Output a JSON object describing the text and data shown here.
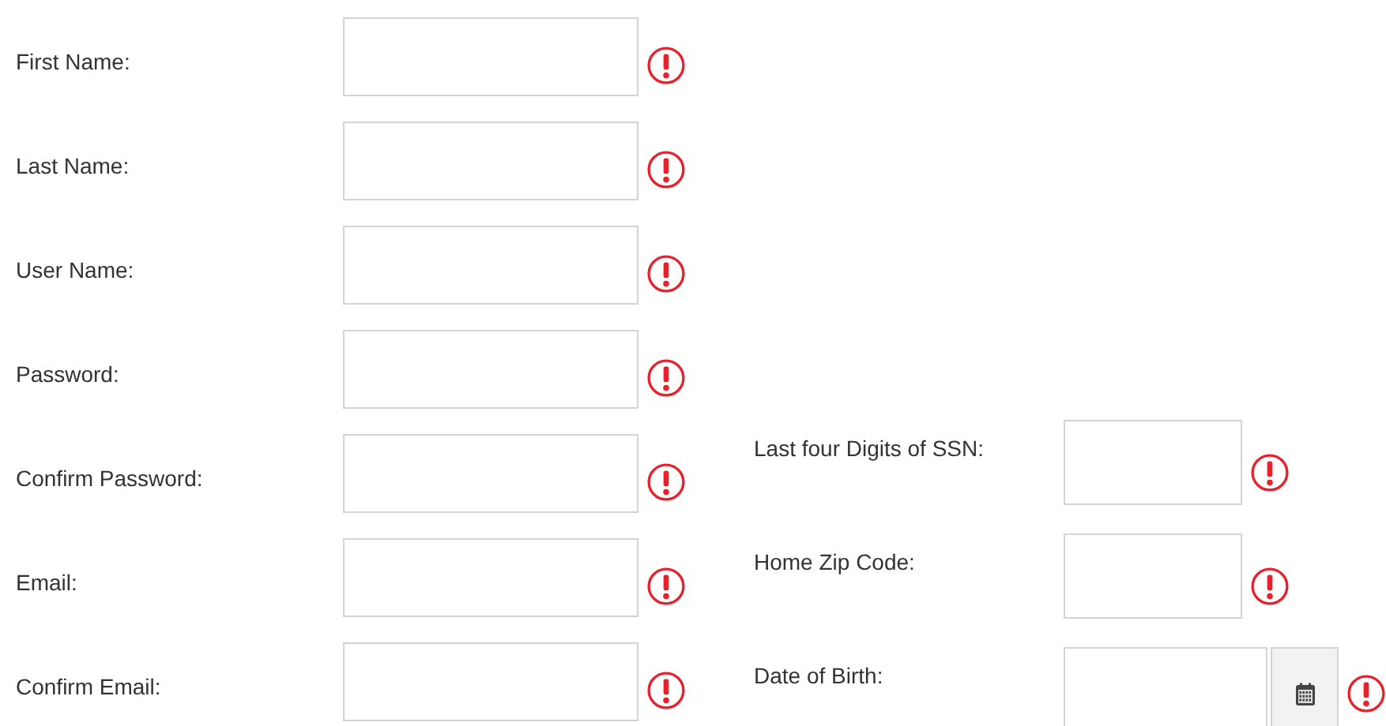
{
  "left_fields": [
    {
      "label": "First Name:",
      "invalid": true
    },
    {
      "label": "Last Name:",
      "invalid": true
    },
    {
      "label": "User Name:",
      "invalid": true
    },
    {
      "label": "Password:",
      "invalid": true
    },
    {
      "label": "Confirm Password:",
      "invalid": true
    },
    {
      "label": "Email:",
      "invalid": true
    },
    {
      "label": "Confirm Email:",
      "invalid": true
    }
  ],
  "right_fields": [
    {
      "label": "Last four Digits of SSN:",
      "kind": "text",
      "invalid": true
    },
    {
      "label": "Home Zip Code:",
      "kind": "text",
      "invalid": true
    },
    {
      "label": "Date of Birth:",
      "kind": "date",
      "invalid": true
    }
  ]
}
